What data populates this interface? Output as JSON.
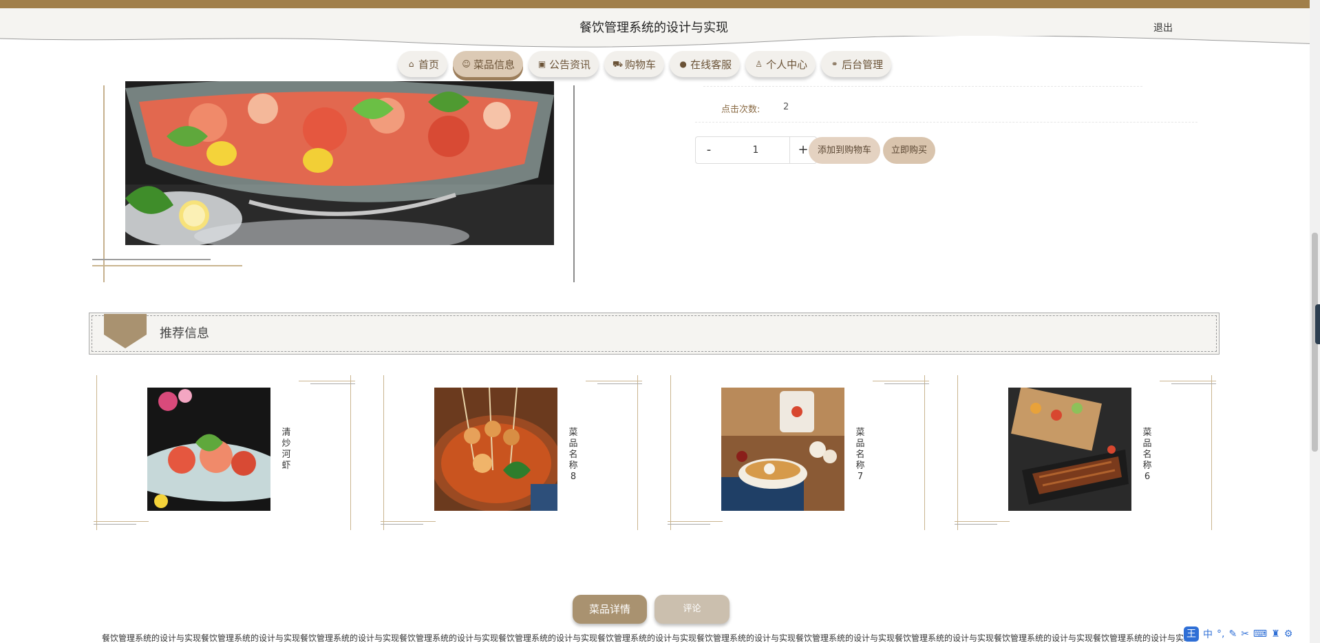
{
  "header": {
    "title": "餐饮管理系统的设计与实现",
    "logout_label": "退出"
  },
  "nav": {
    "items": [
      {
        "label": "首页",
        "icon": "home-icon",
        "glyph": "⌂"
      },
      {
        "label": "菜品信息",
        "icon": "face-icon",
        "glyph": "☺",
        "active": true
      },
      {
        "label": "公告资讯",
        "icon": "gift-icon",
        "glyph": "▣"
      },
      {
        "label": "购物车",
        "icon": "cart-icon",
        "glyph": "⛟"
      },
      {
        "label": "在线客服",
        "icon": "chat-icon",
        "glyph": "●"
      },
      {
        "label": "个人中心",
        "icon": "user-icon",
        "glyph": "♙"
      },
      {
        "label": "后台管理",
        "icon": "link-icon",
        "glyph": "⚭"
      }
    ]
  },
  "product": {
    "clicks_label": "点击次数:",
    "clicks_value": "2",
    "quantity": "1",
    "minus_label": "-",
    "plus_label": "+",
    "add_to_cart_label": "添加到购物车",
    "buy_now_label": "立即购买"
  },
  "recommend": {
    "title": "推荐信息",
    "items": [
      {
        "name": "清炒河虾"
      },
      {
        "name": "菜品名称8"
      },
      {
        "name": "菜品名称7"
      },
      {
        "name": "菜品名称6"
      }
    ]
  },
  "tabs": {
    "detail_label": "菜品详情",
    "comment_label": "评论"
  },
  "footer_text": "餐饮管理系统的设计与实现餐饮管理系统的设计与实现餐饮管理系统的设计与实现餐饮管理系统的设计与实现餐饮管理系统的设计与实现餐饮管理系统的设计与实现餐饮管理系统的设计与实现餐饮管理系统的设计与实现餐饮管理系统的设计与实现餐饮管理系统的设计与实现餐饮管理系统的设计与实现餐饮管理系统的设计与实现餐饮管理系",
  "ime": {
    "logo": "王",
    "mode": "中"
  },
  "colors": {
    "brand_brown": "#a17f4a",
    "pill_active": "#dccab5",
    "tab_detail": "#a99270",
    "tab_comment": "#cbbfae"
  }
}
